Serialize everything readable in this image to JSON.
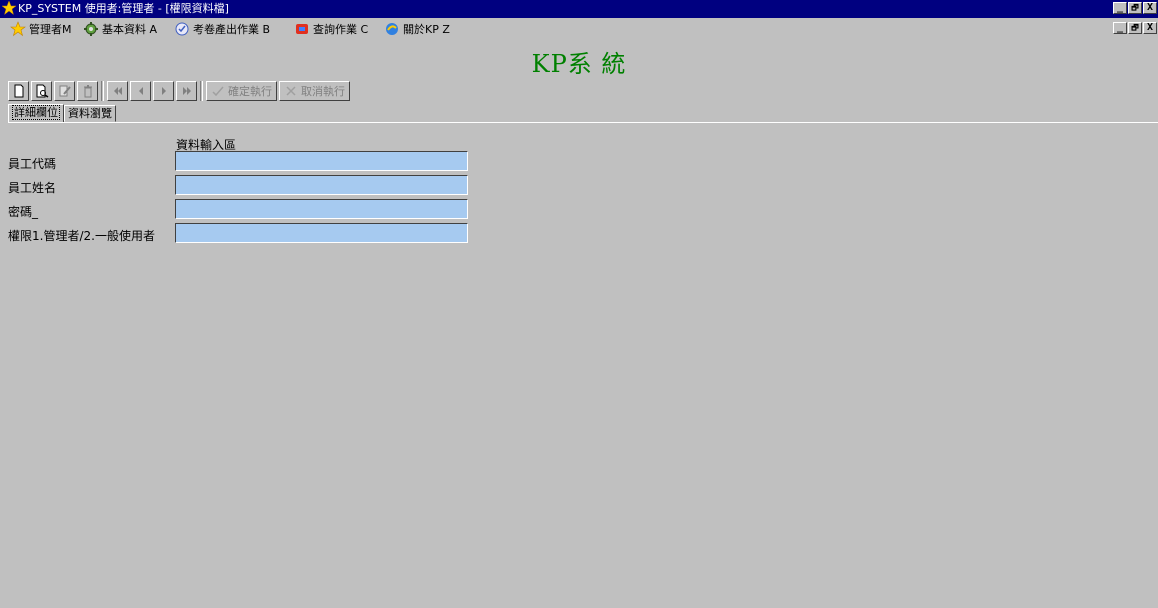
{
  "window": {
    "title": "KP_SYSTEM 使用者:管理者 - [權限資料檔]",
    "buttons": {
      "minimize": "_",
      "restore": "🗗",
      "close": "X"
    }
  },
  "menubar": {
    "items": [
      {
        "label": "管理者M",
        "icon": "star-icon"
      },
      {
        "label": "基本資料 A",
        "icon": "gear-icon"
      },
      {
        "label": "考卷產出作業 B",
        "icon": "document-icon"
      },
      {
        "label": "查詢作業 C",
        "icon": "search-icon"
      },
      {
        "label": "關於KP Z",
        "icon": "info-icon"
      }
    ]
  },
  "app": {
    "title": "KP系 統"
  },
  "toolbar": {
    "icons": [
      "new-icon",
      "preview-icon",
      "edit-icon",
      "delete-icon",
      "first-icon",
      "prev-icon",
      "next-icon",
      "last-icon"
    ],
    "confirm_label": "確定執行",
    "cancel_label": "取消執行"
  },
  "tabs": [
    {
      "label": "詳細欄位",
      "active": true
    },
    {
      "label": "資料瀏覽",
      "active": false
    }
  ],
  "form": {
    "section_title": "資料輸入區",
    "fields": [
      {
        "label": "員工代碼",
        "value": ""
      },
      {
        "label": "員工姓名",
        "value": ""
      },
      {
        "label": "密碼_",
        "value": ""
      },
      {
        "label": "權限1.管理者/2.一般使用者",
        "value": ""
      }
    ]
  },
  "colors": {
    "titlebar": "#000080",
    "app_title": "#008000",
    "input_bg": "#a6caf0",
    "window_bg": "#c0c0c0"
  }
}
